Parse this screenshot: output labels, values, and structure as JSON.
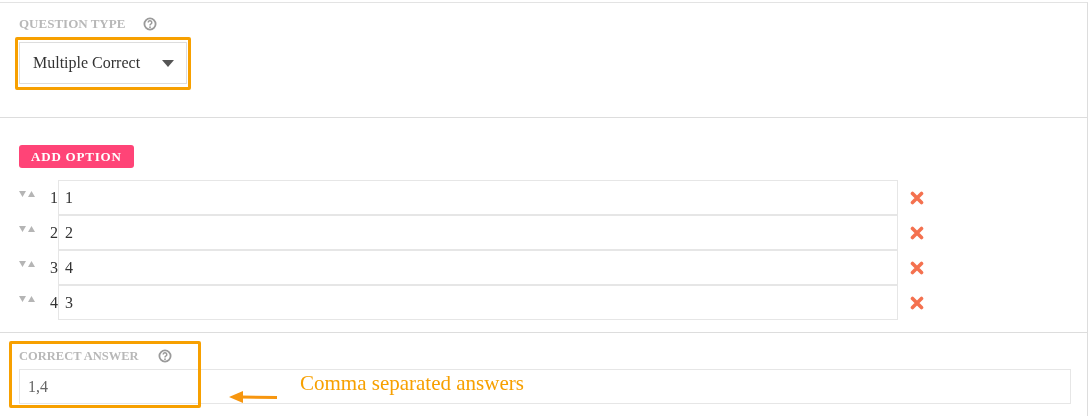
{
  "question_type": {
    "label": "QUESTION TYPE",
    "value": "Multiple Correct"
  },
  "add_option_button": "ADD OPTION",
  "options": [
    {
      "number": "1",
      "value": "1"
    },
    {
      "number": "2",
      "value": "2"
    },
    {
      "number": "3",
      "value": "4"
    },
    {
      "number": "4",
      "value": "3"
    }
  ],
  "correct_answer": {
    "label": "CORRECT ANSWER",
    "value": "1,4"
  },
  "annotation": {
    "text": "Comma separated answers"
  }
}
